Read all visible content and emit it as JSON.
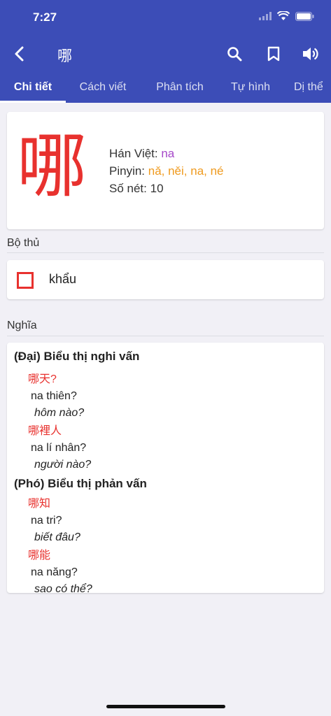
{
  "status": {
    "time": "7:27"
  },
  "toolbar": {
    "title": "哪"
  },
  "tabs": [
    {
      "label": "Chi tiết",
      "active": true
    },
    {
      "label": "Cách viết"
    },
    {
      "label": "Phân tích"
    },
    {
      "label": "Tự hình"
    },
    {
      "label": "Dị thể"
    }
  ],
  "character": {
    "glyph": "哪",
    "han_viet_label": "Hán Việt: ",
    "han_viet": "na",
    "pinyin_label": "Pinyin: ",
    "pinyin": "nǎ, něi, na, né",
    "strokes_label": "Số nét: ",
    "strokes": "10"
  },
  "radical": {
    "section_label": "Bộ thủ",
    "name": "khẩu"
  },
  "meanings": {
    "section_label": "Nghĩa",
    "groups": [
      {
        "pos": "(Đại) Biểu thị nghi vấn",
        "examples": [
          {
            "zh": "哪天?",
            "viet": "na thiên?",
            "mean": "hôm nào?"
          },
          {
            "zh": "哪裡人",
            "viet": "na lí nhân?",
            "mean": "người nào?"
          }
        ]
      },
      {
        "pos": "(Phó) Biểu thị phản vấn",
        "examples": [
          {
            "zh": "哪知",
            "viet": "na tri?",
            "mean": "biết đâu?"
          },
          {
            "zh": "哪能",
            "viet": "na năng?",
            "mean": "sao có thể?"
          }
        ]
      }
    ]
  },
  "colors": {
    "appbar": "#3c4db7",
    "accent_red": "#e8312e",
    "han_viet": "#a648c9",
    "pinyin": "#ef9a1e"
  }
}
